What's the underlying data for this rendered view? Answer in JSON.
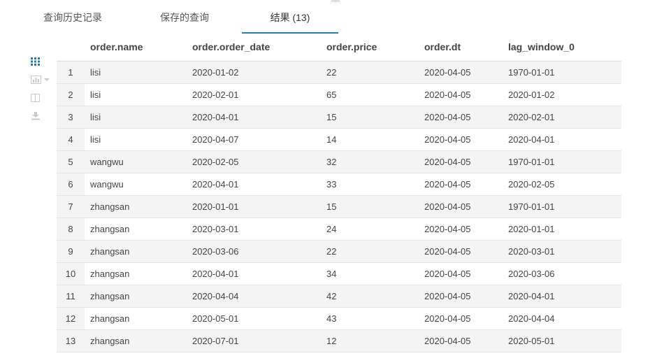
{
  "tabs": [
    {
      "label": "查询历史记录"
    },
    {
      "label": "保存的查询"
    },
    {
      "label": "结果 (13)"
    }
  ],
  "side_icons": [
    "grid-icon",
    "chart-icon",
    "columns-icon",
    "download-icon"
  ],
  "colors": {
    "accent": "#2a7aa8",
    "icon_active": "#2a7aa8",
    "icon_inactive": "#c8c8c8",
    "row_alt": "#f4f4f4"
  },
  "table": {
    "columns": [
      "order.name",
      "order.order_date",
      "order.price",
      "order.dt",
      "lag_window_0"
    ],
    "rows": [
      [
        "1",
        "lisi",
        "2020-01-02",
        "22",
        "2020-04-05",
        "1970-01-01"
      ],
      [
        "2",
        "lisi",
        "2020-02-01",
        "65",
        "2020-04-05",
        "2020-01-02"
      ],
      [
        "3",
        "lisi",
        "2020-04-01",
        "15",
        "2020-04-05",
        "2020-02-01"
      ],
      [
        "4",
        "lisi",
        "2020-04-07",
        "14",
        "2020-04-05",
        "2020-04-01"
      ],
      [
        "5",
        "wangwu",
        "2020-02-05",
        "32",
        "2020-04-05",
        "1970-01-01"
      ],
      [
        "6",
        "wangwu",
        "2020-04-01",
        "33",
        "2020-04-05",
        "2020-02-05"
      ],
      [
        "7",
        "zhangsan",
        "2020-01-01",
        "15",
        "2020-04-05",
        "1970-01-01"
      ],
      [
        "8",
        "zhangsan",
        "2020-03-01",
        "24",
        "2020-04-05",
        "2020-01-01"
      ],
      [
        "9",
        "zhangsan",
        "2020-03-06",
        "22",
        "2020-04-05",
        "2020-03-01"
      ],
      [
        "10",
        "zhangsan",
        "2020-04-01",
        "34",
        "2020-04-05",
        "2020-03-06"
      ],
      [
        "11",
        "zhangsan",
        "2020-04-04",
        "42",
        "2020-04-05",
        "2020-04-01"
      ],
      [
        "12",
        "zhangsan",
        "2020-05-01",
        "43",
        "2020-04-05",
        "2020-04-04"
      ],
      [
        "13",
        "zhangsan",
        "2020-07-01",
        "12",
        "2020-04-05",
        "2020-05-01"
      ]
    ]
  }
}
